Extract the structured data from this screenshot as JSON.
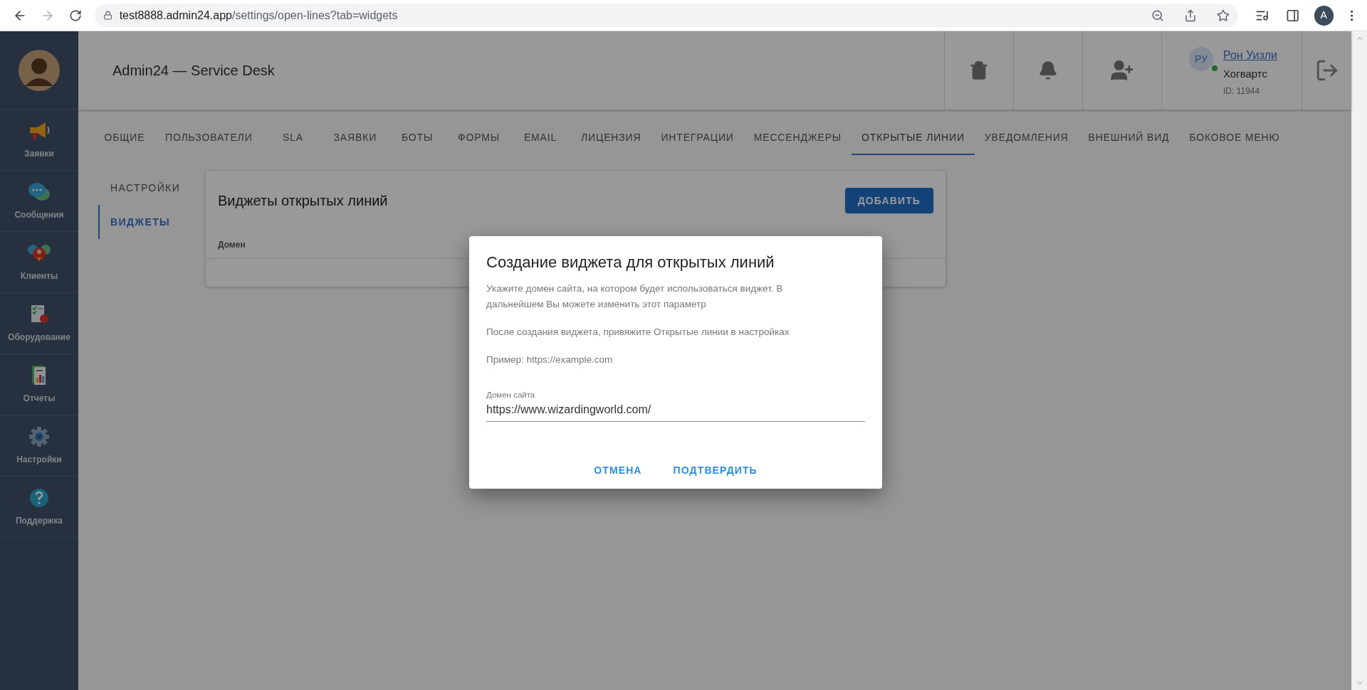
{
  "browser": {
    "forward_disabled": true,
    "url_domain": "test8888.admin24.app",
    "url_path": "/settings/open-lines?tab=widgets",
    "profile_initial": "A"
  },
  "sidebar": {
    "items": [
      {
        "label": "Заявки",
        "kind": "megaphone"
      },
      {
        "label": "Сообщения",
        "kind": "chat"
      },
      {
        "label": "Клиенты",
        "kind": "clients"
      },
      {
        "label": "Оборудование",
        "kind": "equipment"
      },
      {
        "label": "Отчеты",
        "kind": "reports"
      },
      {
        "label": "Настройки",
        "kind": "settings"
      },
      {
        "label": "Поддержка",
        "kind": "help"
      }
    ]
  },
  "header": {
    "title": "Admin24 — Service Desk",
    "user": {
      "initials": "РУ",
      "name": "Рон Уизли",
      "org": "Хогвартс",
      "id": "ID: 11944",
      "online": true
    }
  },
  "tabs": [
    {
      "label": "ОБЩИЕ",
      "selected": false
    },
    {
      "label": "ПОЛЬЗОВАТЕЛИ",
      "selected": false
    },
    {
      "label": "SLA",
      "selected": false
    },
    {
      "label": "ЗАЯВКИ",
      "selected": false
    },
    {
      "label": "БОТЫ",
      "selected": false
    },
    {
      "label": "ФОРМЫ",
      "selected": false
    },
    {
      "label": "EMAIL",
      "selected": false
    },
    {
      "label": "ЛИЦЕНЗИЯ",
      "selected": false
    },
    {
      "label": "ИНТЕГРАЦИИ",
      "selected": false
    },
    {
      "label": "МЕССЕНДЖЕРЫ",
      "selected": false
    },
    {
      "label": "ОТКРЫТЫЕ ЛИНИИ",
      "selected": true
    },
    {
      "label": "УВЕДОМЛЕНИЯ",
      "selected": false
    },
    {
      "label": "ВНЕШНИЙ ВИД",
      "selected": false
    },
    {
      "label": "БОКОВОЕ МЕНЮ",
      "selected": false
    }
  ],
  "subnav": [
    {
      "label": "НАСТРОЙКИ",
      "selected": false
    },
    {
      "label": "ВИДЖЕТЫ",
      "selected": true
    }
  ],
  "card": {
    "title": "Виджеты открытых линий",
    "add_button": "ДОБАВИТЬ",
    "columns": [
      "Домен"
    ]
  },
  "dialog": {
    "title": "Создание виджета для открытых линий",
    "paragraphs": [
      "Укажите домен сайта, на котором будет использоваться виджет. В дальнейшем Вы можете изменить этот параметр",
      "После создания виджета, привяжите Открытые линии в настройках",
      "Пример: https://example.com"
    ],
    "field": {
      "label": "Домен сайта",
      "value": "https://www.wizardingworld.com/"
    },
    "buttons": [
      "ОТМЕНА",
      "ПОДТВЕРДИТЬ"
    ]
  }
}
